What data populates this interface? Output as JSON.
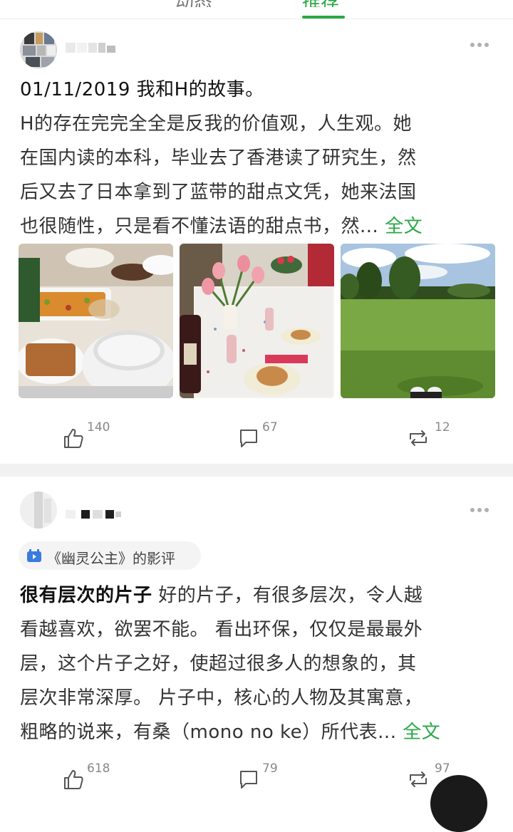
{
  "tabs": [
    {
      "label": "动态",
      "active": false
    },
    {
      "label": "推荐",
      "active": true
    }
  ],
  "colors": {
    "accent": "#2aa845",
    "text": "#333333",
    "meta": "#888888"
  },
  "posts": [
    {
      "lead": "01/11/2019  我和H的故事。",
      "lines": [
        "H的存在完完全全是反我的价值观，人生观。她",
        "在国内读的本科，毕业去了香港读了研究生，然",
        "后又去了日本拿到了蓝带的甜点文凭，她来法国",
        "也很随性，只是看不懂法语的甜点书，然..."
      ],
      "more_label": "全文",
      "photos": [
        {
          "icon": "dinner-table-photo"
        },
        {
          "icon": "tulip-table-photo"
        },
        {
          "icon": "park-lawn-photo"
        }
      ],
      "actions": {
        "likes": "140",
        "comments": "67",
        "reposts": "12"
      }
    },
    {
      "review_tag": "《幽灵公主》的影评",
      "lead": "很有层次的片子",
      "first_line_rest": "  好的片子，有很多层次，令人越",
      "lines": [
        "看越喜欢，欲罢不能。 看出环保，仅仅是最最外",
        "层，这个片子之好，使超过很多人的想象的，其",
        "层次非常深厚。 片子中，核心的人物及其寓意，",
        "粗略的说来，有桑（mono no ke）所代表..."
      ],
      "more_label": "全文",
      "actions": {
        "likes": "618",
        "comments": "79",
        "reposts": "97"
      }
    }
  ]
}
